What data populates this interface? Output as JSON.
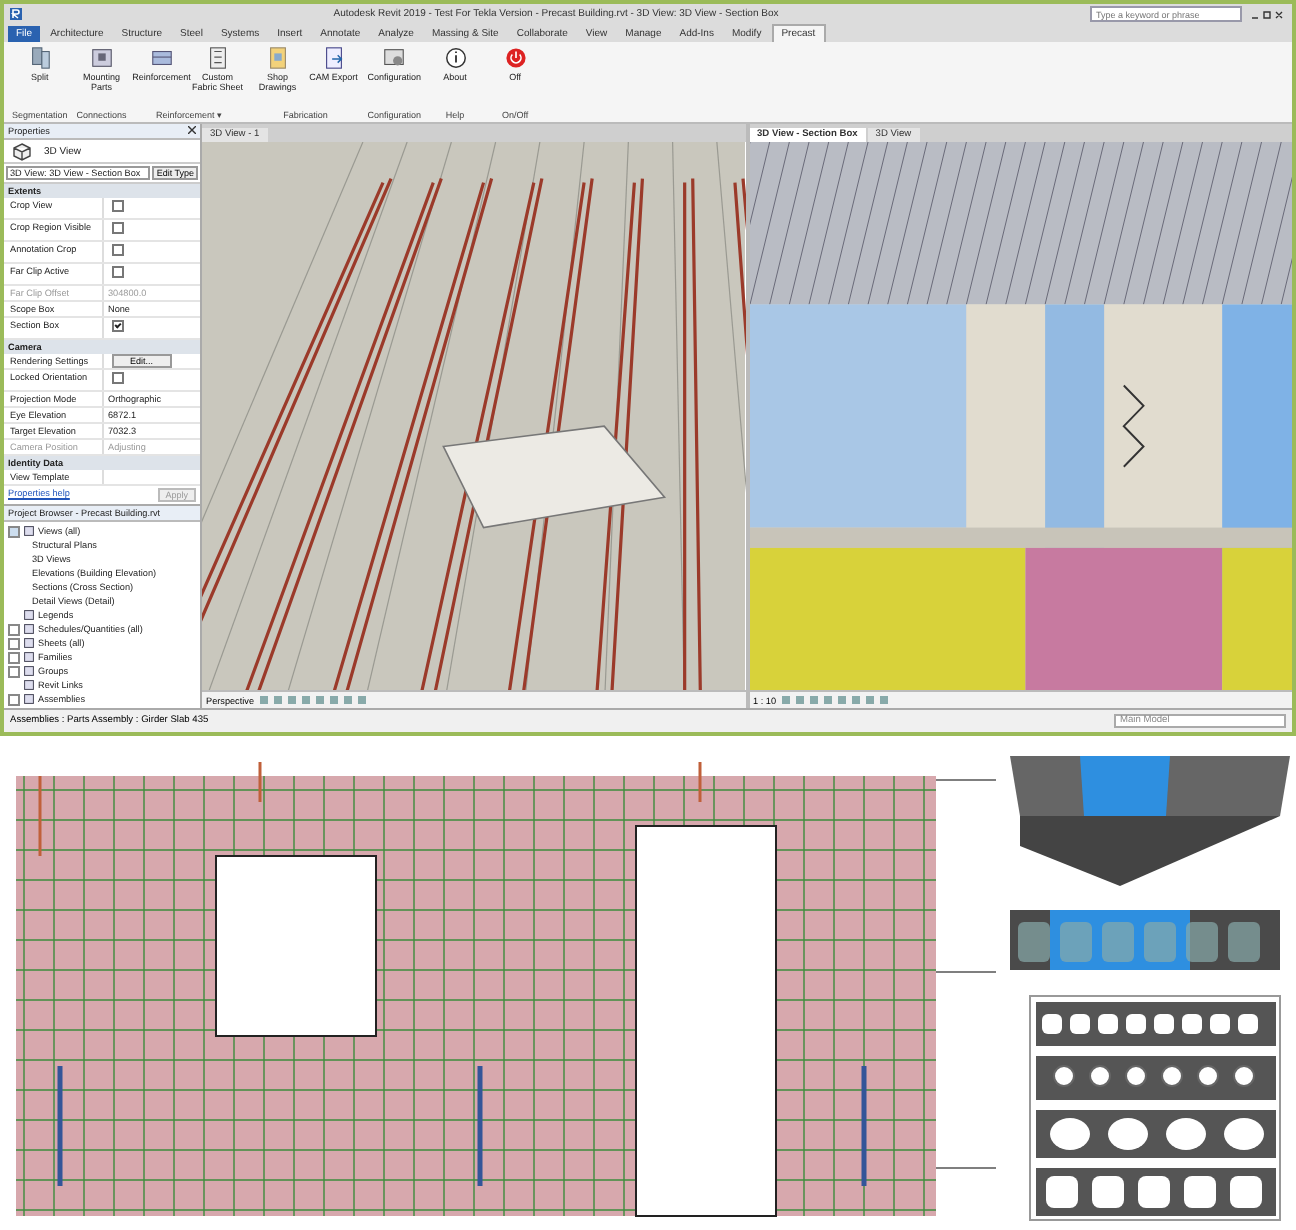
{
  "window": {
    "title": "Autodesk Revit 2019 - Test For Tekla Version - Precast Building.rvt - 3D View: 3D View - Section Box"
  },
  "search": {
    "placeholder": "Type a keyword or phrase"
  },
  "ribbon_tabs": [
    {
      "label": "File",
      "selected": false
    },
    {
      "label": "Architecture",
      "selected": false
    },
    {
      "label": "Structure",
      "selected": false
    },
    {
      "label": "Steel",
      "selected": false
    },
    {
      "label": "Systems",
      "selected": false
    },
    {
      "label": "Insert",
      "selected": false
    },
    {
      "label": "Annotate",
      "selected": false
    },
    {
      "label": "Analyze",
      "selected": false
    },
    {
      "label": "Massing & Site",
      "selected": false
    },
    {
      "label": "Collaborate",
      "selected": false
    },
    {
      "label": "View",
      "selected": false
    },
    {
      "label": "Manage",
      "selected": false
    },
    {
      "label": "Add-Ins",
      "selected": false
    },
    {
      "label": "Modify",
      "selected": false
    },
    {
      "label": "Precast",
      "selected": true
    }
  ],
  "ribbon_panels": [
    {
      "title": "Segmentation",
      "buttons": [
        "Split"
      ]
    },
    {
      "title": "Connections",
      "buttons": [
        "Mounting Parts"
      ]
    },
    {
      "title": "Reinforcement ▾",
      "buttons": [
        "Reinforcement",
        "Custom Fabric Sheet"
      ]
    },
    {
      "title": "Fabrication",
      "buttons": [
        "Shop Drawings",
        "CAM Export"
      ]
    },
    {
      "title": "Configuration",
      "buttons": [
        "Configuration"
      ]
    },
    {
      "title": "Help",
      "buttons": [
        "About"
      ]
    },
    {
      "title": "On/Off",
      "buttons": [
        "Off"
      ]
    }
  ],
  "properties": {
    "title": "Properties",
    "type": "3D View",
    "selector": "3D View: 3D View - Section Box",
    "edit_type": "Edit Type",
    "groups": [
      {
        "name": "Extents",
        "rows": [
          {
            "label": "Crop View",
            "kind": "checkbox",
            "checked": false
          },
          {
            "label": "Crop Region Visible",
            "kind": "checkbox",
            "checked": false
          },
          {
            "label": "Annotation Crop",
            "kind": "checkbox",
            "checked": false
          },
          {
            "label": "Far Clip Active",
            "kind": "checkbox",
            "checked": false
          },
          {
            "label": "Far Clip Offset",
            "kind": "text",
            "value": "304800.0",
            "disabled": true
          },
          {
            "label": "Scope Box",
            "kind": "text",
            "value": "None",
            "disabled": false
          },
          {
            "label": "Section Box",
            "kind": "checkbox",
            "checked": true
          }
        ]
      },
      {
        "name": "Camera",
        "rows": [
          {
            "label": "Rendering Settings",
            "kind": "button",
            "value": "Edit..."
          },
          {
            "label": "Locked Orientation",
            "kind": "checkbox",
            "checked": false
          },
          {
            "label": "Projection Mode",
            "kind": "text",
            "value": "Orthographic",
            "disabled": false
          },
          {
            "label": "Eye Elevation",
            "kind": "text",
            "value": "6872.1",
            "disabled": false
          },
          {
            "label": "Target Elevation",
            "kind": "text",
            "value": "7032.3",
            "disabled": false
          },
          {
            "label": "Camera Position",
            "kind": "text",
            "value": "Adjusting",
            "disabled": true
          }
        ]
      },
      {
        "name": "Identity Data",
        "rows": [
          {
            "label": "View Template",
            "kind": "text",
            "value": "",
            "disabled": false
          }
        ]
      }
    ],
    "help_link": "Properties help",
    "apply": "Apply"
  },
  "project_browser": {
    "title": "Project Browser - Precast Building.rvt",
    "items": [
      {
        "label": "Views (all)",
        "expanded": true,
        "children": [
          {
            "label": "Structural Plans"
          },
          {
            "label": "3D Views"
          },
          {
            "label": "Elevations (Building Elevation)"
          },
          {
            "label": "Sections (Cross Section)"
          },
          {
            "label": "Detail Views (Detail)"
          }
        ]
      },
      {
        "label": "Legends"
      },
      {
        "label": "Schedules/Quantities (all)",
        "expanded": false
      },
      {
        "label": "Sheets (all)",
        "expanded": false
      },
      {
        "label": "Families",
        "expanded": false
      },
      {
        "label": "Groups",
        "expanded": false
      },
      {
        "label": "Revit Links"
      },
      {
        "label": "Assemblies",
        "expanded": false
      }
    ]
  },
  "view_tabs": [
    {
      "label": "3D View - 1",
      "selected": false
    },
    {
      "label": "3D View - Section Box",
      "selected": true
    },
    {
      "label": "3D View",
      "selected": false
    }
  ],
  "view_bars": [
    "Perspective",
    "1 : 10"
  ],
  "status_bar": {
    "text": "Assemblies : Parts Assembly : Girder Slab 435",
    "model": "Main Model"
  }
}
